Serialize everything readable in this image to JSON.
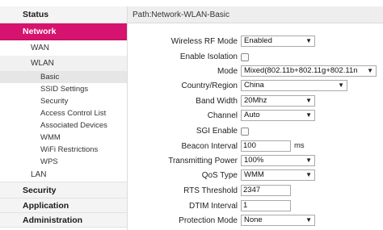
{
  "sidebar": {
    "status": "Status",
    "network": "Network",
    "wan": "WAN",
    "wlan": "WLAN",
    "wlan_items": [
      "Basic",
      "SSID Settings",
      "Security",
      "Access Control List",
      "Associated Devices",
      "WMM",
      "WiFi Restrictions",
      "WPS"
    ],
    "lan": "LAN",
    "security": "Security",
    "application": "Application",
    "administration": "Administration"
  },
  "main": {
    "path": "Path:Network-WLAN-Basic",
    "fields": {
      "rf_mode": {
        "label": "Wireless RF Mode",
        "value": "Enabled"
      },
      "isolation": {
        "label": "Enable Isolation"
      },
      "mode": {
        "label": "Mode",
        "value": "Mixed(802.11b+802.11g+802.11n"
      },
      "country": {
        "label": "Country/Region",
        "value": "China"
      },
      "bandwidth": {
        "label": "Band Width",
        "value": "20Mhz"
      },
      "channel": {
        "label": "Channel",
        "value": "Auto"
      },
      "sgi": {
        "label": "SGI Enable"
      },
      "beacon": {
        "label": "Beacon Interval",
        "value": "100",
        "unit": "ms"
      },
      "tx_power": {
        "label": "Transmitting Power",
        "value": "100%"
      },
      "qos": {
        "label": "QoS Type",
        "value": "WMM"
      },
      "rts": {
        "label": "RTS Threshold",
        "value": "2347"
      },
      "dtim": {
        "label": "DTIM Interval",
        "value": "1"
      },
      "protection": {
        "label": "Protection Mode",
        "value": "None"
      }
    }
  },
  "colors": {
    "accent": "#d6136e"
  }
}
